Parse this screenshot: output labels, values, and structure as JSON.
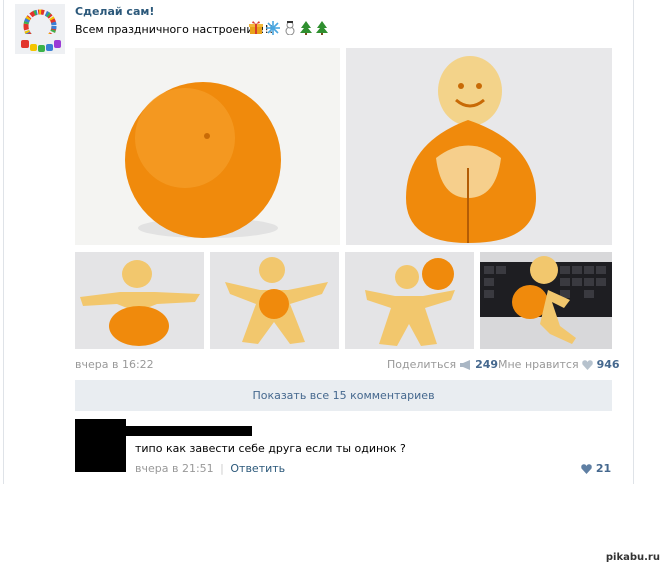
{
  "post": {
    "author": "Сделай сам!",
    "text": "Всем праздничного настроения!!!",
    "emojis": [
      "gift-emoji",
      "snowflake-emoji",
      "snowman-emoji",
      "christmas-tree-emoji",
      "christmas-tree-emoji"
    ],
    "photos": [
      {
        "name": "photo-whole-orange",
        "desc_icon": "orange-image"
      },
      {
        "name": "photo-orange-peel-man",
        "desc_icon": "orange-peel-figure-image"
      },
      {
        "name": "photo-peel-figure-1",
        "desc_icon": "orange-peel-figure-image"
      },
      {
        "name": "photo-peel-figure-2",
        "desc_icon": "orange-peel-figure-image"
      },
      {
        "name": "photo-peel-figure-3",
        "desc_icon": "orange-peel-figure-image"
      },
      {
        "name": "photo-peel-figure-keyboard",
        "desc_icon": "orange-peel-figure-image"
      }
    ],
    "date": "вчера в 16:22",
    "share_label": "Поделиться",
    "share_count": "249",
    "like_label": "Мне нравится",
    "like_count": "946",
    "show_all_comments": "Показать все 15 комментариев"
  },
  "comment": {
    "text": "типо как завести себе друга если ты одинок ?",
    "date": "вчера в 21:51",
    "separator": "|",
    "reply_label": "Ответить",
    "like_count": "21"
  },
  "watermark": "pikabu.ru",
  "colors": {
    "link": "#2b587a",
    "muted": "#999999",
    "accent": "#45688e",
    "orange": "#f08a0c",
    "button_bg": "#e9edf1"
  }
}
